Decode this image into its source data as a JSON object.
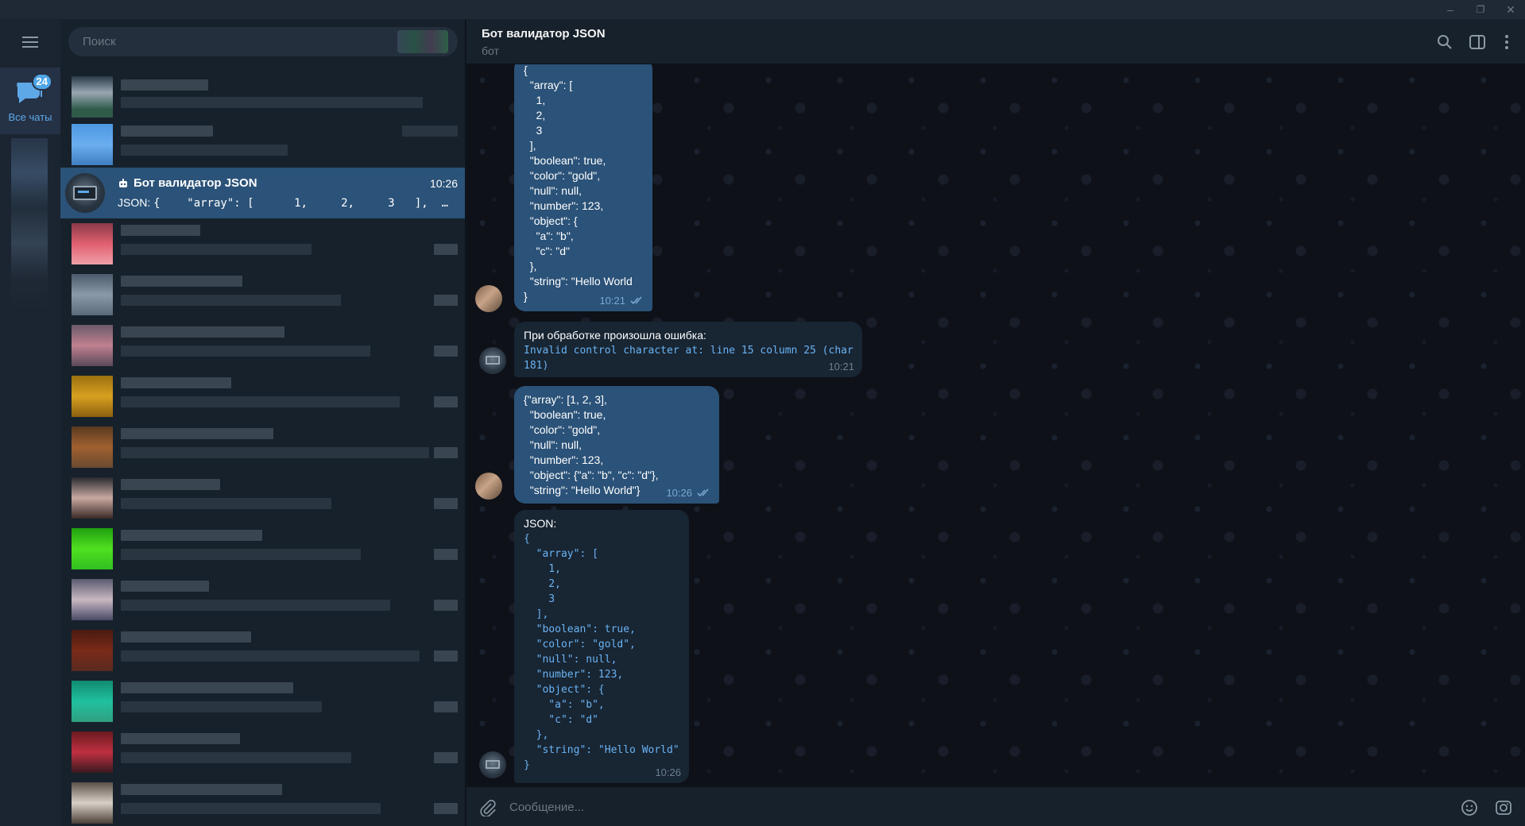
{
  "window": {
    "minimize": "–",
    "restore": "❐",
    "close": "✕"
  },
  "rail": {
    "folder_label": "Все чаты",
    "badge": "24",
    "menu_icon": "hamburger-icon"
  },
  "search": {
    "placeholder": "Поиск"
  },
  "active_chat": {
    "name": "Бот валидатор JSON",
    "time": "10:26",
    "preview_label": "JSON: ",
    "preview_text": "{    \"array\": [      1,     2,     3   ],   \"bo..."
  },
  "header": {
    "title": "Бот валидатор JSON",
    "subtitle": "бот"
  },
  "messages": [
    {
      "direction": "out",
      "text": "{\n  \"array\": [\n    1,\n    2,\n    3\n  ],\n  \"boolean\": true,\n  \"color\": \"gold\",\n  \"null\": null,\n  \"number\": 123,\n  \"object\": {\n    \"a\": \"b\",\n    \"c\": \"d\"\n  },\n  \"string\": \"Hello World\n}",
      "time": "10:21",
      "read": true
    },
    {
      "direction": "in",
      "text": "При обработке произошла ошибка:",
      "code": "Invalid control character at: line 15 column 25 (char\n181)",
      "time": "10:21"
    },
    {
      "direction": "out",
      "text": "{\"array\": [1, 2, 3],\n  \"boolean\": true,\n  \"color\": \"gold\",\n  \"null\": null,\n  \"number\": 123,\n  \"object\": {\"a\": \"b\", \"c\": \"d\"},\n  \"string\": \"Hello World\"}",
      "time": "10:26",
      "read": true
    },
    {
      "direction": "in",
      "text": "JSON:",
      "code": "{\n  \"array\": [\n    1,\n    2,\n    3\n  ],\n  \"boolean\": true,\n  \"color\": \"gold\",\n  \"null\": null,\n  \"number\": 123,\n  \"object\": {\n    \"a\": \"b\",\n    \"c\": \"d\"\n  },\n  \"string\": \"Hello World\"\n}",
      "time": "10:26"
    }
  ],
  "composer": {
    "placeholder": "Сообщение..."
  },
  "colors": {
    "accent": "#5ea8e8",
    "outgoing": "#2b5278",
    "incoming": "#182533",
    "sidebar": "#17212b"
  }
}
